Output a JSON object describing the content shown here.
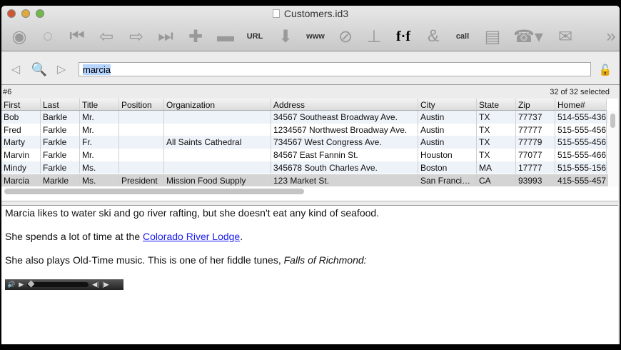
{
  "window": {
    "title": "Customers.id3"
  },
  "toolbar": {
    "items": [
      {
        "name": "back-round-icon",
        "glyph": "◉"
      },
      {
        "name": "forward-round-icon",
        "glyph": "◌"
      },
      {
        "name": "first-record-icon",
        "glyph": "⏮"
      },
      {
        "name": "previous-record-icon",
        "glyph": "⇦"
      },
      {
        "name": "next-record-icon",
        "glyph": "⇨"
      },
      {
        "name": "last-record-icon",
        "glyph": "⏭"
      },
      {
        "name": "add-record-icon",
        "glyph": "✚"
      },
      {
        "name": "delete-record-icon",
        "glyph": "▬"
      },
      {
        "name": "url-icon",
        "glyph": "URL"
      },
      {
        "name": "import-icon",
        "glyph": "⬇"
      },
      {
        "name": "www-icon",
        "glyph": "www"
      },
      {
        "name": "link-icon",
        "glyph": "⊘"
      },
      {
        "name": "ruler-icon",
        "glyph": "⊥"
      },
      {
        "name": "font-icon",
        "glyph": "f·f"
      },
      {
        "name": "ampersand-icon",
        "glyph": "&"
      },
      {
        "name": "highlight-icon",
        "glyph": "call"
      },
      {
        "name": "window-icon",
        "glyph": "▤"
      },
      {
        "name": "phone-icon",
        "glyph": "☎▾"
      },
      {
        "name": "envelope-icon",
        "glyph": "✉"
      },
      {
        "name": "overflow-icon",
        "glyph": "»"
      }
    ]
  },
  "search": {
    "value": "marcia"
  },
  "record": {
    "label": "#6",
    "selection": "32 of 32 selected"
  },
  "table": {
    "columns": [
      "First",
      "Last",
      "Title",
      "Position",
      "Organization",
      "Address",
      "City",
      "State",
      "Zip",
      "Home#"
    ],
    "rows": [
      [
        "Bob",
        "Barkle",
        "Mr.",
        "",
        "",
        "34567 Southeast Broadway Ave.",
        "Austin",
        "TX",
        "77737",
        "514-555-436"
      ],
      [
        "Fred",
        "Farkle",
        "Mr.",
        "",
        "",
        "1234567 Northwest Broadway Ave.",
        "Austin",
        "TX",
        "77777",
        "515-555-456"
      ],
      [
        "Marty",
        "Farkle",
        "Fr.",
        "",
        "All Saints Cathedral",
        "734567 West Congress Ave.",
        "Austin",
        "TX",
        "77779",
        "515-555-456"
      ],
      [
        "Marvin",
        "Farkle",
        "Mr.",
        "",
        "",
        "84567 East Fannin St.",
        "Houston",
        "TX",
        "77077",
        "515-555-466"
      ],
      [
        "Mindy",
        "Farkle",
        "Ms.",
        "",
        "",
        "345678 South Charles Ave.",
        "Boston",
        "MA",
        "17777",
        "515-555-156"
      ],
      [
        "Marcia",
        "Markle",
        "Ms.",
        "President",
        "Mission Food Supply",
        "123 Market St.",
        "San Franci…",
        "CA",
        "93993",
        "415-555-457"
      ]
    ],
    "selected_row": 5
  },
  "notes": {
    "p1": "Marcia likes to water ski and go river rafting, but she doesn't eat any kind of seafood.",
    "p2_before": "She spends a lot of time at the ",
    "p2_link": "Colorado River Lodge",
    "p2_after": ".",
    "p3_before": "She also plays Old-Time music. This is one of her fiddle tunes, ",
    "p3_italic": "Falls of Richmond:"
  }
}
